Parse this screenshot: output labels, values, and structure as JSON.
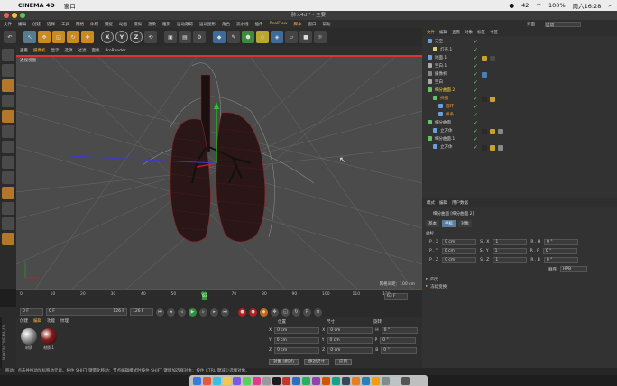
{
  "macbar": {
    "app": "CINEMA 4D",
    "menu": [
      "窗口"
    ],
    "wechat_count": "42",
    "battery": "100%",
    "datetime": "周六16:28"
  },
  "window": {
    "title": "肺.c4d * - 主要"
  },
  "menu": {
    "items": [
      "文件",
      "编辑",
      "创建",
      "选择",
      "工具",
      "网格",
      "体积",
      "捕捉",
      "动画",
      "模拟",
      "渲染",
      "雕刻",
      "运动跟踪",
      "运动图形",
      "角色",
      "流水线",
      "插件",
      "RealFlow",
      "脚本",
      "窗口",
      "帮助"
    ],
    "layout_label": "界面",
    "layout_value": "启动"
  },
  "toolbar": {
    "x": "X",
    "y": "Y",
    "z": "Z"
  },
  "viewport": {
    "tabs": [
      "查看",
      "摄像机",
      "显示",
      "选项",
      "过滤",
      "面板",
      "ProRender"
    ],
    "label": "透视视图",
    "grid_distance": "网格间距：100 cm"
  },
  "timeline": {
    "ticks": [
      "0",
      "10",
      "20",
      "30",
      "40",
      "50",
      "60",
      "70",
      "80",
      "90",
      "100",
      "110",
      "120"
    ],
    "current_frame": "63",
    "frame_end_field": "63 F"
  },
  "playback": {
    "start": "0 F",
    "start2": "0 F",
    "end": "126 F",
    "end2": "126 F"
  },
  "materials": {
    "tabs": [
      "创建",
      "编辑",
      "功能",
      "纹理"
    ],
    "items": [
      {
        "name": "材质",
        "color": "#9a9a9a"
      },
      {
        "name": "材质.1",
        "color": "#8a1a1a"
      }
    ],
    "brand": "MAXON CINEMA 4D"
  },
  "coords": {
    "headers": [
      "位置",
      "尺寸",
      "旋转"
    ],
    "rows": [
      {
        "axis": "X",
        "pos": "0 cm",
        "size": "0 cm",
        "rot_label": "H",
        "rot": "0 °"
      },
      {
        "axis": "Y",
        "pos": "0 cm",
        "size": "0 cm",
        "rot_label": "P",
        "rot": "0 °"
      },
      {
        "axis": "Z",
        "pos": "0 cm",
        "size": "0 cm",
        "rot_label": "B",
        "rot": "0 °"
      }
    ],
    "mode": "对象 (相对)",
    "size_mode": "绝对尺寸",
    "apply": "应用"
  },
  "objects": {
    "tabs": [
      "文件",
      "编辑",
      "查看",
      "对象",
      "标签",
      "书签"
    ],
    "rows": [
      {
        "name": "天空",
        "indent": 0,
        "icon": "#6aa0d8",
        "tags": []
      },
      {
        "name": "灯光.1",
        "indent": 6,
        "icon": "#d8d26a",
        "tags": []
      },
      {
        "name": "地面.1",
        "indent": 0,
        "icon": "#6aa0d8",
        "tags": [
          "#c9a22c",
          "#4a4a4a"
        ]
      },
      {
        "name": "空白.1",
        "indent": 0,
        "icon": "#aaaaaa",
        "tags": []
      },
      {
        "name": "摄像机",
        "indent": 0,
        "icon": "#888888",
        "tags": [
          "#4b7fb5"
        ]
      },
      {
        "name": "空白",
        "indent": 0,
        "icon": "#aaaaaa",
        "tags": []
      },
      {
        "name": "细分曲面.2",
        "indent": 0,
        "icon": "#66c266",
        "tags": [],
        "highlight": true
      },
      {
        "name": "扫描",
        "indent": 6,
        "icon": "#66c266",
        "tags": [
          "#2a2a2a",
          "#c9a22c"
        ],
        "orange": true
      },
      {
        "name": "圆环",
        "indent": 12,
        "icon": "#6aa0d8",
        "tags": [],
        "orange": true
      },
      {
        "name": "样条",
        "indent": 12,
        "icon": "#6aa0d8",
        "tags": [],
        "orange": true
      },
      {
        "name": "细分曲面",
        "indent": 0,
        "icon": "#66c266",
        "tags": []
      },
      {
        "name": "立方体",
        "indent": 6,
        "icon": "#6aa0d8",
        "tags": [
          "#2a2a2a",
          "#c9a22c",
          "#888888"
        ]
      },
      {
        "name": "细分曲面.1",
        "indent": 0,
        "icon": "#66c266",
        "tags": []
      },
      {
        "name": "立方体",
        "indent": 6,
        "icon": "#6aa0d8",
        "tags": [
          "#2a2a2a",
          "#c9a22c",
          "#888888"
        ]
      }
    ]
  },
  "attributes": {
    "tabs": [
      "模式",
      "编辑",
      "用户数据"
    ],
    "title": "细分曲面 [细分曲面.2]",
    "subtabs": [
      "基本",
      "坐标",
      "对象"
    ],
    "section": "坐标",
    "rows": [
      {
        "p": "P . X",
        "pv": "0 cm",
        "s": "S . X",
        "sv": "1",
        "r": "R . H",
        "rv": "0 °"
      },
      {
        "p": "P . Y",
        "pv": "0 cm",
        "s": "S . Y",
        "sv": "1",
        "r": "R . P",
        "rv": "0 °"
      },
      {
        "p": "P . Z",
        "pv": "0 cm",
        "s": "S . Z",
        "sv": "1",
        "r": "R . B",
        "rv": "0 °"
      }
    ],
    "order_label": "顺序",
    "order_value": "HPB",
    "collapsed": [
      "四元",
      "冻结变换"
    ]
  },
  "status": {
    "text": "移动：点击并拖动鼠标移动元素。按住 SHIFT 键量化移动；节点编辑模式时按住 SHIFT 键增加选择对象；按住 CTRL 键减少选择对象。"
  },
  "colors": {
    "accent": "#f5b342",
    "selection": "#5a7ea0",
    "timeline_red": "#cc2222"
  }
}
